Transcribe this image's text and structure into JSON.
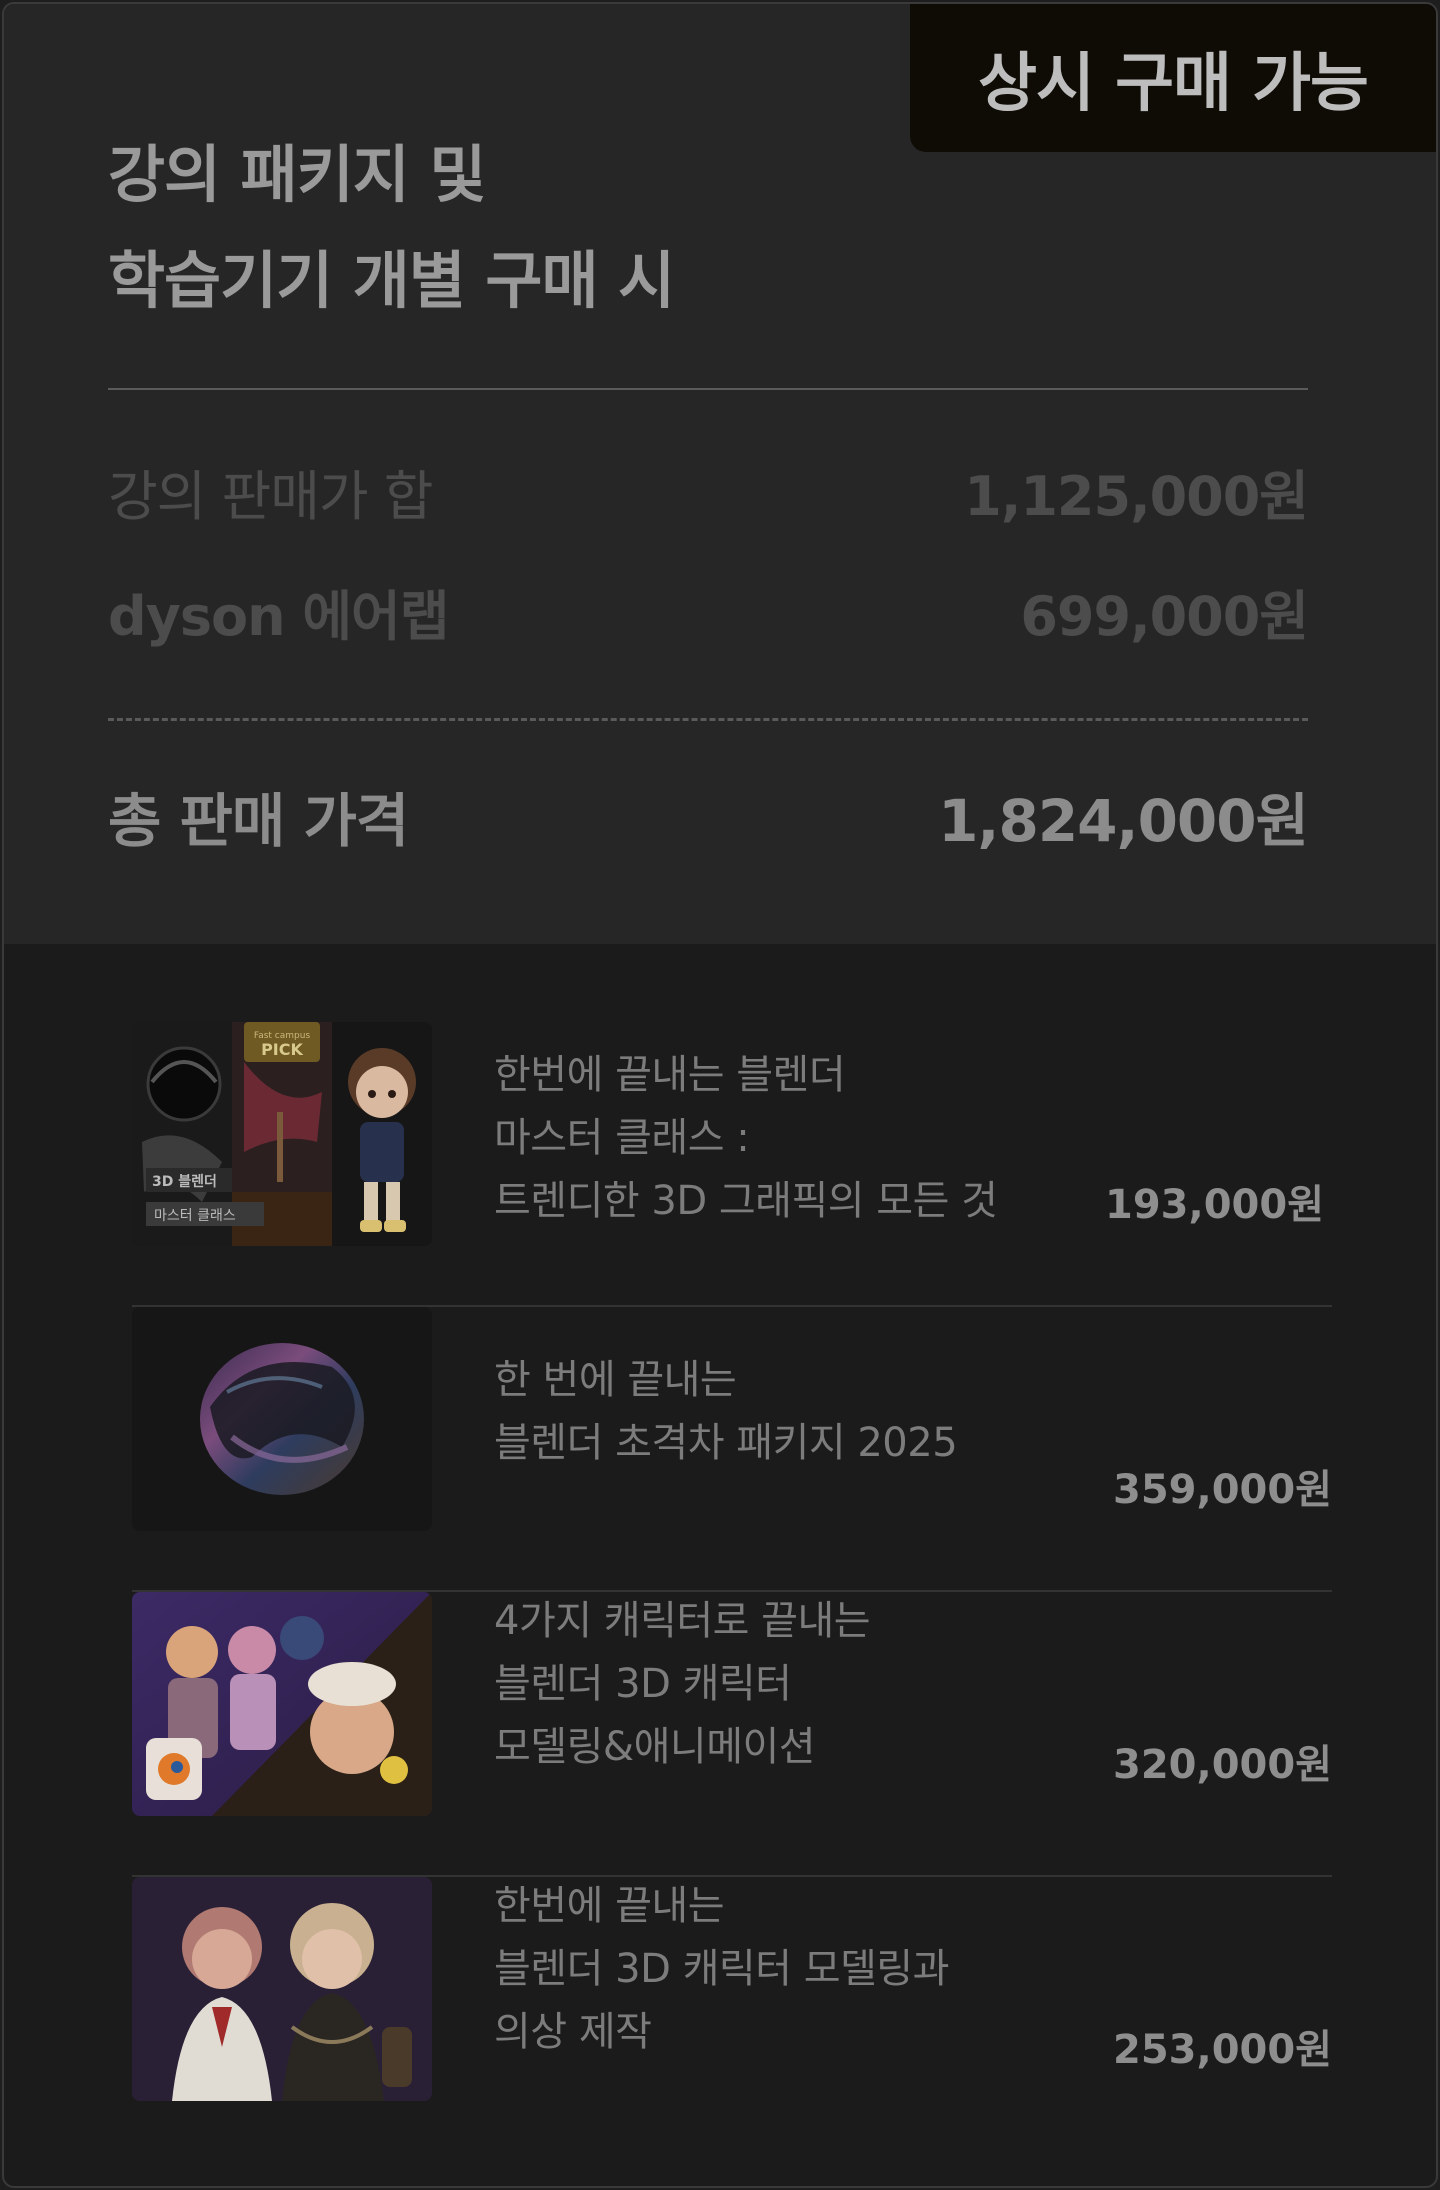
{
  "badge": "상시 구매 가능",
  "heading": {
    "line1": "강의 패키지 및",
    "line2": "학습기기 개별 구매 시"
  },
  "summary": [
    {
      "label": "강의 판매가 합",
      "price": "1,125,000원"
    },
    {
      "label": "dyson 에어랩",
      "price": "699,000원"
    }
  ],
  "total": {
    "label": "총 판매 가격",
    "price": "1,824,000원"
  },
  "items": [
    {
      "lines": [
        "한번에 끝내는 블렌더",
        "마스터 클래스 :",
        "트렌디한 3D 그래픽의 모든 것"
      ],
      "price": "193,000원",
      "thumb_tags": [
        "3D 블렌더",
        "마스터 클래스"
      ],
      "thumb_pick_small": "Fast campus",
      "thumb_pick": "PICK"
    },
    {
      "lines": [
        "한 번에 끝내는",
        "블렌더 초격차 패키지 2025"
      ],
      "price": "359,000원"
    },
    {
      "lines": [
        "4가지 캐릭터로 끝내는",
        "블렌더 3D 캐릭터",
        "모델링&애니메이션"
      ],
      "price": "320,000원"
    },
    {
      "lines": [
        "한번에 끝내는",
        "블렌더 3D 캐릭터 모델링과",
        "의상 제작"
      ],
      "price": "253,000원"
    }
  ],
  "colors": {
    "card_top": "#262627",
    "card_bottom": "#1b1b1b",
    "badge_bg": "#0f0c06"
  }
}
